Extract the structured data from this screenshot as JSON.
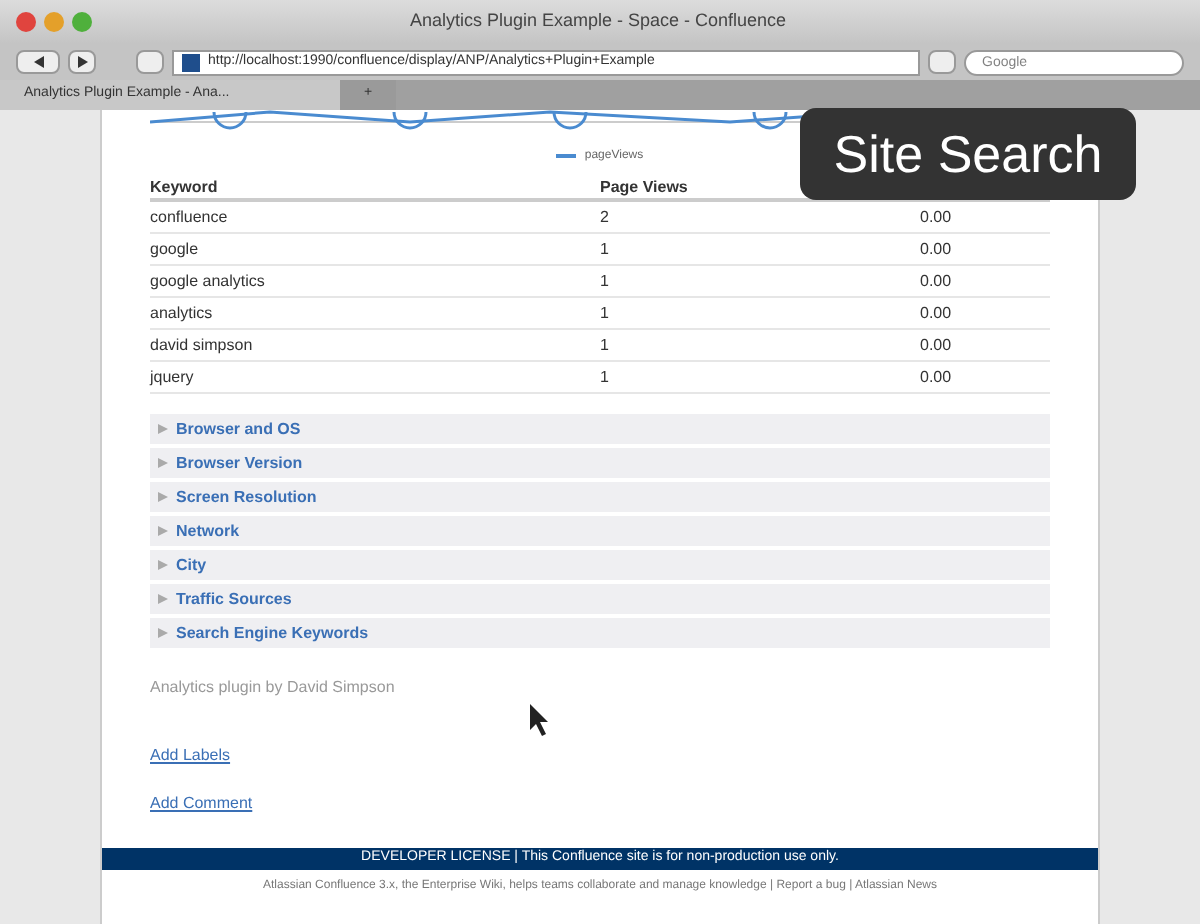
{
  "window": {
    "title": "Analytics Plugin Example - Space - Confluence"
  },
  "toolbar": {
    "url": "http://localhost:1990/confluence/display/ANP/Analytics+Plugin+Example",
    "search_placeholder": "Google"
  },
  "tabs": [
    {
      "label": "Analytics Plugin Example - Ana...",
      "selected": true
    },
    {
      "label": "+",
      "selected": false
    }
  ],
  "chart": {
    "legend": "pageViews"
  },
  "overlay": {
    "title": "Site Search"
  },
  "table": {
    "columns": [
      "Keyword",
      "Page Views"
    ],
    "rows": [
      [
        "confluence",
        "2",
        "0.00"
      ],
      [
        "google",
        "1",
        "0.00"
      ],
      [
        "google analytics",
        "1",
        "0.00"
      ],
      [
        "analytics",
        "1",
        "0.00"
      ],
      [
        "david simpson",
        "1",
        "0.00"
      ],
      [
        "jquery",
        "1",
        "0.00"
      ]
    ]
  },
  "sections": [
    {
      "label": "Browser and OS",
      "expanded": false
    },
    {
      "label": "Browser Version",
      "expanded": false
    },
    {
      "label": "Screen Resolution",
      "expanded": false
    },
    {
      "label": "Network",
      "expanded": false
    },
    {
      "label": "City",
      "expanded": false
    },
    {
      "label": "Traffic Sources",
      "expanded": false
    },
    {
      "label": "Search Engine Keywords",
      "expanded": false
    }
  ],
  "credit": "Analytics plugin by David Simpson",
  "links": [
    "Add Labels",
    "Add Comment"
  ],
  "banner": "DEVELOPER LICENSE | This Confluence site is for non-production use only.",
  "footer": "Atlassian Confluence 3.x, the Enterprise Wiki, helps teams collaborate and manage knowledge | Report a bug | Atlassian News"
}
